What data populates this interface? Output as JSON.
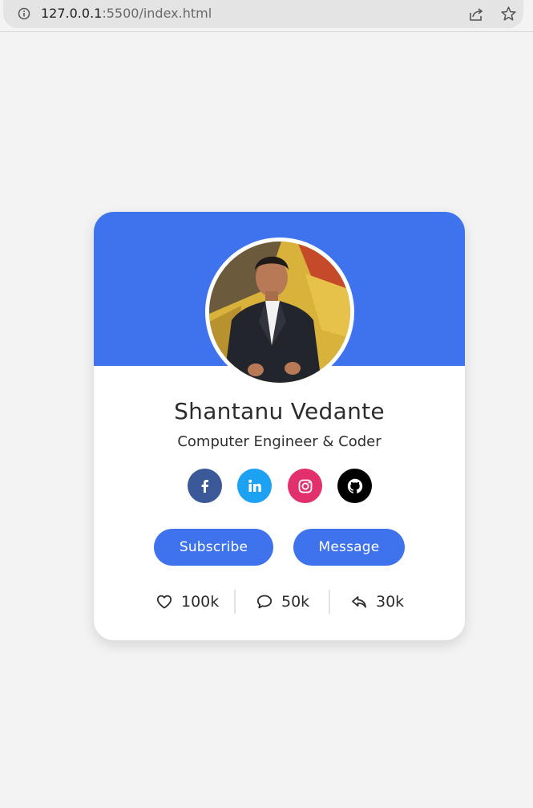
{
  "browser": {
    "url_host": "127.0.0.1",
    "url_path": ":5500/index.html"
  },
  "profile": {
    "name": "Shantanu Vedante",
    "role": "Computer Engineer & Coder",
    "avatar_icon": "profile-photo"
  },
  "social": [
    {
      "name": "facebook",
      "icon": "facebook-icon",
      "color": "#3b5998"
    },
    {
      "name": "linkedin",
      "icon": "linkedin-icon",
      "color": "#1da1f2"
    },
    {
      "name": "instagram",
      "icon": "instagram-icon",
      "color": "#e1306c"
    },
    {
      "name": "github",
      "icon": "github-icon",
      "color": "#000000"
    }
  ],
  "buttons": {
    "subscribe": "Subscribe",
    "message": "Message"
  },
  "stats": {
    "likes": "100k",
    "comments": "50k",
    "shares": "30k"
  },
  "colors": {
    "accent": "#3f73ee",
    "page_bg": "#f3f3f3"
  }
}
